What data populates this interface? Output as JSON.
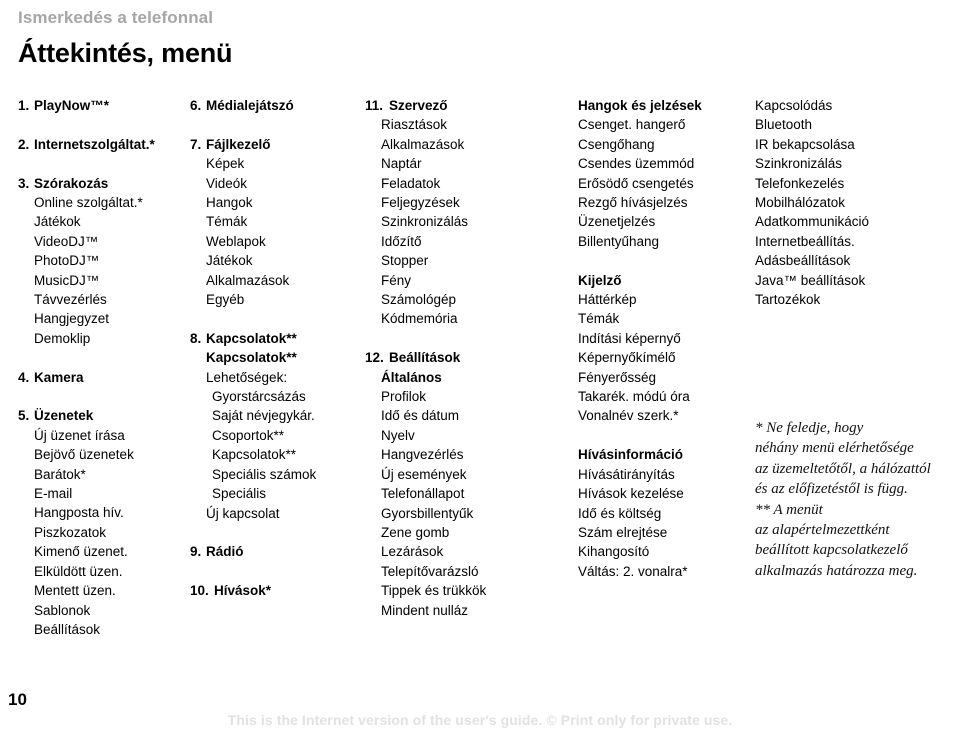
{
  "running_head": "Ismerkedés a telefonnal",
  "page_title": "Áttekintés, menü",
  "footer": {
    "page_number": "10",
    "notice": "This is the Internet version of the user's guide. © Print only for private use."
  },
  "columns": [
    {
      "id": "column-1",
      "lines": [
        {
          "num": "1.",
          "text": "PlayNow™*",
          "bold": true,
          "indent": 0
        },
        {
          "gap": true
        },
        {
          "num": "2.",
          "text": "Internetszolgáltat.*",
          "bold": true,
          "indent": 0
        },
        {
          "gap": true
        },
        {
          "num": "3.",
          "text": "Szórakozás",
          "bold": true,
          "indent": 0
        },
        {
          "text": "Online szolgáltat.*",
          "bold": false,
          "indent": 1
        },
        {
          "text": "Játékok",
          "bold": false,
          "indent": 1
        },
        {
          "text": "VideoDJ™",
          "bold": false,
          "indent": 1
        },
        {
          "text": "PhotoDJ™",
          "bold": false,
          "indent": 1
        },
        {
          "text": "MusicDJ™",
          "bold": false,
          "indent": 1
        },
        {
          "text": "Távvezérlés",
          "bold": false,
          "indent": 1
        },
        {
          "text": "Hangjegyzet",
          "bold": false,
          "indent": 1
        },
        {
          "text": "Demoklip",
          "bold": false,
          "indent": 1
        },
        {
          "gap": true
        },
        {
          "num": "4.",
          "text": "Kamera",
          "bold": true,
          "indent": 0
        },
        {
          "gap": true
        },
        {
          "num": "5.",
          "text": "Üzenetek",
          "bold": true,
          "indent": 0
        },
        {
          "text": "Új üzenet írása",
          "bold": false,
          "indent": 1
        },
        {
          "text": "Bejövő üzenetek",
          "bold": false,
          "indent": 1
        },
        {
          "text": "Barátok*",
          "bold": false,
          "indent": 1
        },
        {
          "text": "E-mail",
          "bold": false,
          "indent": 1
        },
        {
          "text": "Hangposta hív.",
          "bold": false,
          "indent": 1
        },
        {
          "text": "Piszkozatok",
          "bold": false,
          "indent": 1
        },
        {
          "text": "Kimenő üzenet.",
          "bold": false,
          "indent": 1
        },
        {
          "text": "Elküldött üzen.",
          "bold": false,
          "indent": 1
        },
        {
          "text": "Mentett üzen.",
          "bold": false,
          "indent": 1
        },
        {
          "text": "Sablonok",
          "bold": false,
          "indent": 1
        },
        {
          "text": "Beállítások",
          "bold": false,
          "indent": 1
        }
      ]
    },
    {
      "id": "column-2",
      "lines": [
        {
          "num": "6.",
          "text": "Médialejátszó",
          "bold": true,
          "indent": 0
        },
        {
          "gap": true
        },
        {
          "num": "7.",
          "text": "Fájlkezelő",
          "bold": true,
          "indent": 0
        },
        {
          "text": "Képek",
          "bold": false,
          "indent": 1
        },
        {
          "text": "Videók",
          "bold": false,
          "indent": 1
        },
        {
          "text": "Hangok",
          "bold": false,
          "indent": 1
        },
        {
          "text": "Témák",
          "bold": false,
          "indent": 1
        },
        {
          "text": "Weblapok",
          "bold": false,
          "indent": 1
        },
        {
          "text": "Játékok",
          "bold": false,
          "indent": 1
        },
        {
          "text": "Alkalmazások",
          "bold": false,
          "indent": 1
        },
        {
          "text": "Egyéb",
          "bold": false,
          "indent": 1
        },
        {
          "gap": true
        },
        {
          "num": "8.",
          "text": "Kapcsolatok**",
          "bold": true,
          "indent": 0
        },
        {
          "text": "Kapcsolatok**",
          "bold": true,
          "indent": 1
        },
        {
          "text": "Lehetőségek:",
          "bold": false,
          "indent": 1
        },
        {
          "text": "Gyorstárcsázás",
          "bold": false,
          "indent": 2
        },
        {
          "text": "Saját névjegykár.",
          "bold": false,
          "indent": 2
        },
        {
          "text": "Csoportok**",
          "bold": false,
          "indent": 2
        },
        {
          "text": "Kapcsolatok**",
          "bold": false,
          "indent": 2
        },
        {
          "text": "Speciális számok",
          "bold": false,
          "indent": 2
        },
        {
          "text": "Speciális",
          "bold": false,
          "indent": 2
        },
        {
          "text": "Új kapcsolat",
          "bold": false,
          "indent": 1
        },
        {
          "gap": true
        },
        {
          "num": "9.",
          "text": "Rádió",
          "bold": true,
          "indent": 0
        },
        {
          "gap": true
        },
        {
          "num": "10.",
          "text": "Hívások*",
          "bold": true,
          "indent": 0,
          "wide": true
        }
      ]
    },
    {
      "id": "column-3",
      "lines": [
        {
          "num": "11.",
          "text": "Szervező",
          "bold": true,
          "indent": 0,
          "wide": true
        },
        {
          "text": "Riasztások",
          "bold": false,
          "indent": 1
        },
        {
          "text": "Alkalmazások",
          "bold": false,
          "indent": 1
        },
        {
          "text": "Naptár",
          "bold": false,
          "indent": 1
        },
        {
          "text": "Feladatok",
          "bold": false,
          "indent": 1
        },
        {
          "text": "Feljegyzések",
          "bold": false,
          "indent": 1
        },
        {
          "text": "Szinkronizálás",
          "bold": false,
          "indent": 1
        },
        {
          "text": "Időzítő",
          "bold": false,
          "indent": 1
        },
        {
          "text": "Stopper",
          "bold": false,
          "indent": 1
        },
        {
          "text": "Fény",
          "bold": false,
          "indent": 1
        },
        {
          "text": "Számológép",
          "bold": false,
          "indent": 1
        },
        {
          "text": "Kódmemória",
          "bold": false,
          "indent": 1
        },
        {
          "gap": true
        },
        {
          "num": "12.",
          "text": "Beállítások",
          "bold": true,
          "indent": 0,
          "wide": true
        },
        {
          "text": "Általános",
          "bold": true,
          "indent": 1
        },
        {
          "text": "Profilok",
          "bold": false,
          "indent": 1
        },
        {
          "text": "Idő és dátum",
          "bold": false,
          "indent": 1
        },
        {
          "text": "Nyelv",
          "bold": false,
          "indent": 1
        },
        {
          "text": "Hangvezérlés",
          "bold": false,
          "indent": 1
        },
        {
          "text": "Új események",
          "bold": false,
          "indent": 1
        },
        {
          "text": "Telefonállapot",
          "bold": false,
          "indent": 1
        },
        {
          "text": "Gyorsbillentyűk",
          "bold": false,
          "indent": 1
        },
        {
          "text": "Zene gomb",
          "bold": false,
          "indent": 1
        },
        {
          "text": "Lezárások",
          "bold": false,
          "indent": 1
        },
        {
          "text": "Telepítővarázsló",
          "bold": false,
          "indent": 1
        },
        {
          "text": "Tippek és trükkök",
          "bold": false,
          "indent": 1
        },
        {
          "text": "Mindent nulláz",
          "bold": false,
          "indent": 1
        }
      ]
    },
    {
      "id": "column-4",
      "lines": [
        {
          "text": "Hangok és jelzések",
          "bold": true,
          "indent": 0
        },
        {
          "text": "Csenget. hangerő",
          "bold": false,
          "indent": 0
        },
        {
          "text": "Csengőhang",
          "bold": false,
          "indent": 0
        },
        {
          "text": "Csendes üzemmód",
          "bold": false,
          "indent": 0
        },
        {
          "text": "Erősödő csengetés",
          "bold": false,
          "indent": 0
        },
        {
          "text": "Rezgő hívásjelzés",
          "bold": false,
          "indent": 0
        },
        {
          "text": "Üzenetjelzés",
          "bold": false,
          "indent": 0
        },
        {
          "text": "Billentyűhang",
          "bold": false,
          "indent": 0
        },
        {
          "gap": true
        },
        {
          "text": "Kijelző",
          "bold": true,
          "indent": 0
        },
        {
          "text": "Háttérkép",
          "bold": false,
          "indent": 0
        },
        {
          "text": "Témák",
          "bold": false,
          "indent": 0
        },
        {
          "text": "Indítási képernyő",
          "bold": false,
          "indent": 0
        },
        {
          "text": "Képernyőkímélő",
          "bold": false,
          "indent": 0
        },
        {
          "text": "Fényerősség",
          "bold": false,
          "indent": 0
        },
        {
          "text": "Takarék. módú óra",
          "bold": false,
          "indent": 0
        },
        {
          "text": "Vonalnév szerk.*",
          "bold": false,
          "indent": 0
        },
        {
          "gap": true
        },
        {
          "text": "Hívásinformáció",
          "bold": true,
          "indent": 0
        },
        {
          "text": "Hívásátirányítás",
          "bold": false,
          "indent": 0
        },
        {
          "text": "Hívások kezelése",
          "bold": false,
          "indent": 0
        },
        {
          "text": "Idő és költség",
          "bold": false,
          "indent": 0
        },
        {
          "text": "Szám elrejtése",
          "bold": false,
          "indent": 0
        },
        {
          "text": "Kihangosító",
          "bold": false,
          "indent": 0
        },
        {
          "text": "Váltás: 2. vonalra*",
          "bold": false,
          "indent": 0
        }
      ]
    },
    {
      "id": "column-5",
      "lines": [
        {
          "text": "Kapcsolódás",
          "bold": false,
          "indent": 0
        },
        {
          "text": "Bluetooth",
          "bold": false,
          "indent": 0
        },
        {
          "text": "IR bekapcsolása",
          "bold": false,
          "indent": 0
        },
        {
          "text": "Szinkronizálás",
          "bold": false,
          "indent": 0
        },
        {
          "text": "Telefonkezelés",
          "bold": false,
          "indent": 0
        },
        {
          "text": "Mobilhálózatok",
          "bold": false,
          "indent": 0
        },
        {
          "text": "Adatkommunikáció",
          "bold": false,
          "indent": 0
        },
        {
          "text": "Internetbeállítás.",
          "bold": false,
          "indent": 0
        },
        {
          "text": "Adásbeállítások",
          "bold": false,
          "indent": 0
        },
        {
          "text": "Java™ beállítások",
          "bold": false,
          "indent": 0
        },
        {
          "text": "Tartozékok",
          "bold": false,
          "indent": 0
        }
      ]
    }
  ],
  "footnote": {
    "lines": [
      "* Ne feledje, hogy",
      "néhány menü elérhetősége",
      "az üzemeltetőtől, a hálózattól",
      "és az előfizetéstől is függ.",
      "** A menüt",
      "az alapértelmezettként",
      "beállított kapcsolatkezelő",
      "alkalmazás határozza meg."
    ]
  }
}
